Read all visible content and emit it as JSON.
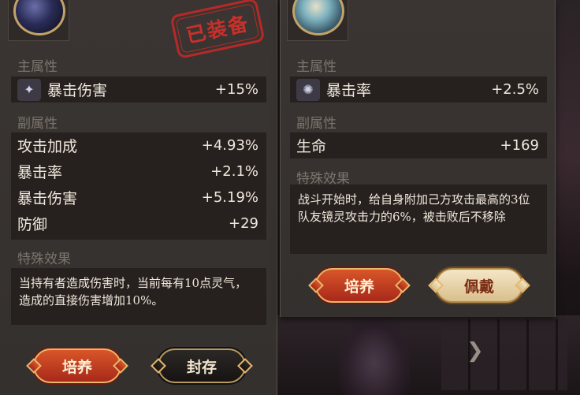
{
  "left_card": {
    "stamp": "已装备",
    "main_section": "主属性",
    "main_stat": {
      "icon": "crit-damage-icon",
      "name": "暴击伤害",
      "value": "+15%"
    },
    "sub_section": "副属性",
    "sub_stats": [
      {
        "name": "攻击加成",
        "value": "+4.93%"
      },
      {
        "name": "暴击率",
        "value": "+2.1%"
      },
      {
        "name": "暴击伤害",
        "value": "+5.19%"
      },
      {
        "name": "防御",
        "value": "+29"
      }
    ],
    "effect_section": "特殊效果",
    "effect_text": "当持有者造成伤害时，当前每有10点灵气，造成的直接伤害增加10%。",
    "buttons": {
      "upgrade": "培养",
      "seal": "封存"
    }
  },
  "right_card": {
    "main_section": "主属性",
    "main_stat": {
      "icon": "crit-rate-icon",
      "name": "暴击率",
      "value": "+2.5%"
    },
    "sub_section": "副属性",
    "sub_stats": [
      {
        "name": "生命",
        "value": "+169"
      }
    ],
    "effect_section": "特殊效果",
    "effect_text": "战斗开始时，给自身附加己方攻击最高的3位队友镜灵攻击力的6%，被击败后不移除",
    "buttons": {
      "upgrade": "培养",
      "equip": "佩戴"
    }
  },
  "colors": {
    "panel": "#37322f",
    "row": "#26211f",
    "text": "#f1e8dc",
    "label": "#7c746c",
    "stamp": "#c9302b",
    "red_button": "#c0401f",
    "gold_border": "#e8b86a"
  }
}
